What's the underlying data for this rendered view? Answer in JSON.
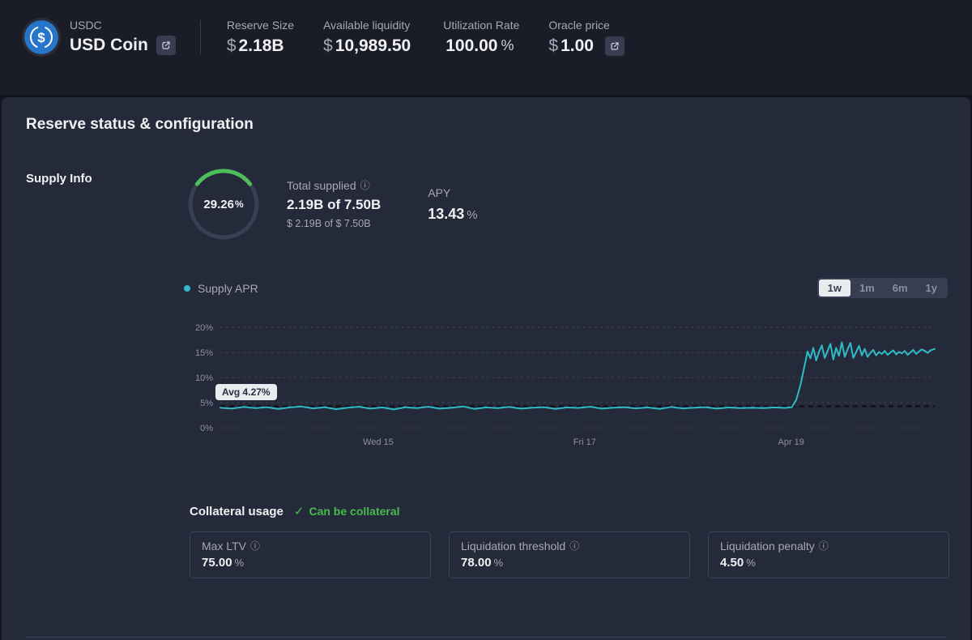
{
  "header": {
    "symbol": "USDC",
    "name": "USD Coin",
    "stats": [
      {
        "label": "Reserve Size",
        "prefix": "$",
        "value": "2.18B"
      },
      {
        "label": "Available liquidity",
        "prefix": "$",
        "value": "10,989.50"
      },
      {
        "label": "Utilization Rate",
        "prefix": "",
        "value": "100.00",
        "suffix": "%"
      },
      {
        "label": "Oracle price",
        "prefix": "$",
        "value": "1.00"
      }
    ]
  },
  "panel": {
    "title": "Reserve status & configuration",
    "section_label": "Supply Info"
  },
  "supply": {
    "gauge_percent": "29.26",
    "gauge_suffix": "%",
    "total_supplied_label": "Total supplied",
    "total_supplied": "2.19B of 7.50B",
    "total_supplied_usd": "$ 2.19B of $ 7.50B",
    "apy_label": "APY",
    "apy_value": "13.43",
    "apy_suffix": "%"
  },
  "chart": {
    "legend": "Supply APR",
    "ranges": [
      "1w",
      "1m",
      "6m",
      "1y"
    ],
    "selected_range": "1w",
    "avg_label": "Avg 4.27%"
  },
  "chart_data": {
    "type": "line",
    "title": "Supply APR",
    "ylim": [
      0,
      20
    ],
    "yticks": [
      0,
      5,
      10,
      15,
      20
    ],
    "ytick_labels": [
      "0%",
      "5%",
      "10%",
      "15%",
      "20%"
    ],
    "xtick_labels": [
      {
        "label": "Wed 15",
        "x": 0.221
      },
      {
        "label": "Fri 17",
        "x": 0.51
      },
      {
        "label": "Apr 19",
        "x": 0.799
      }
    ],
    "avg": 4.27,
    "grid": true,
    "legend_position": "top-left",
    "series": [
      {
        "name": "Supply APR",
        "color": "#2EBAC6",
        "points": [
          [
            0,
            4.0
          ],
          [
            0.016,
            3.8
          ],
          [
            0.033,
            4.15
          ],
          [
            0.049,
            3.9
          ],
          [
            0.065,
            4.1
          ],
          [
            0.081,
            3.75
          ],
          [
            0.097,
            4.05
          ],
          [
            0.113,
            4.25
          ],
          [
            0.13,
            3.85
          ],
          [
            0.146,
            4.1
          ],
          [
            0.162,
            3.7
          ],
          [
            0.178,
            4.0
          ],
          [
            0.194,
            4.2
          ],
          [
            0.21,
            3.8
          ],
          [
            0.227,
            4.05
          ],
          [
            0.243,
            3.65
          ],
          [
            0.259,
            4.1
          ],
          [
            0.275,
            3.9
          ],
          [
            0.291,
            4.2
          ],
          [
            0.307,
            3.8
          ],
          [
            0.324,
            4.0
          ],
          [
            0.34,
            4.25
          ],
          [
            0.356,
            3.75
          ],
          [
            0.372,
            4.05
          ],
          [
            0.388,
            3.9
          ],
          [
            0.404,
            4.15
          ],
          [
            0.421,
            3.8
          ],
          [
            0.437,
            4.0
          ],
          [
            0.453,
            4.1
          ],
          [
            0.469,
            3.75
          ],
          [
            0.485,
            4.05
          ],
          [
            0.501,
            3.95
          ],
          [
            0.518,
            4.2
          ],
          [
            0.534,
            3.8
          ],
          [
            0.55,
            4.0
          ],
          [
            0.566,
            4.1
          ],
          [
            0.582,
            3.85
          ],
          [
            0.598,
            4.05
          ],
          [
            0.615,
            3.75
          ],
          [
            0.631,
            4.15
          ],
          [
            0.647,
            3.85
          ],
          [
            0.663,
            4.0
          ],
          [
            0.679,
            4.1
          ],
          [
            0.695,
            3.8
          ],
          [
            0.712,
            4.05
          ],
          [
            0.728,
            3.9
          ],
          [
            0.744,
            4.0
          ],
          [
            0.76,
            3.9
          ],
          [
            0.776,
            4.05
          ],
          [
            0.79,
            3.95
          ],
          [
            0.8,
            4.1
          ],
          [
            0.806,
            5.5
          ],
          [
            0.812,
            8.5
          ],
          [
            0.818,
            12.5
          ],
          [
            0.822,
            15.2
          ],
          [
            0.826,
            13.8
          ],
          [
            0.83,
            15.9
          ],
          [
            0.834,
            13.4
          ],
          [
            0.838,
            15.1
          ],
          [
            0.842,
            16.4
          ],
          [
            0.846,
            13.9
          ],
          [
            0.85,
            15.3
          ],
          [
            0.854,
            16.7
          ],
          [
            0.858,
            13.6
          ],
          [
            0.862,
            15.9
          ],
          [
            0.866,
            14.3
          ],
          [
            0.87,
            17.0
          ],
          [
            0.874,
            14.1
          ],
          [
            0.878,
            15.6
          ],
          [
            0.882,
            16.9
          ],
          [
            0.886,
            13.9
          ],
          [
            0.89,
            15.1
          ],
          [
            0.894,
            16.3
          ],
          [
            0.898,
            14.4
          ],
          [
            0.902,
            15.7
          ],
          [
            0.906,
            14.1
          ],
          [
            0.91,
            14.9
          ],
          [
            0.914,
            15.5
          ],
          [
            0.918,
            14.4
          ],
          [
            0.922,
            15.1
          ],
          [
            0.926,
            14.7
          ],
          [
            0.93,
            15.3
          ],
          [
            0.934,
            14.5
          ],
          [
            0.938,
            15.0
          ],
          [
            0.942,
            15.4
          ],
          [
            0.946,
            14.6
          ],
          [
            0.95,
            15.1
          ],
          [
            0.954,
            14.8
          ],
          [
            0.958,
            15.3
          ],
          [
            0.962,
            14.5
          ],
          [
            0.966,
            15.0
          ],
          [
            0.97,
            15.5
          ],
          [
            0.974,
            14.7
          ],
          [
            0.978,
            15.2
          ],
          [
            0.982,
            15.6
          ],
          [
            0.986,
            15.3
          ],
          [
            0.99,
            14.9
          ],
          [
            0.994,
            15.4
          ],
          [
            1,
            15.7
          ]
        ]
      }
    ]
  },
  "collateral": {
    "title": "Collateral usage",
    "check_icon": "✓",
    "status": "Can be collateral",
    "items": [
      {
        "label": "Max LTV",
        "value": "75.00",
        "suffix": "%"
      },
      {
        "label": "Liquidation threshold",
        "value": "78.00",
        "suffix": "%"
      },
      {
        "label": "Liquidation penalty",
        "value": "4.50",
        "suffix": "%"
      }
    ]
  },
  "icons": {
    "info": "ⓘ"
  },
  "colors": {
    "accent_teal": "#2EBAC6",
    "success_green": "#46BC4B",
    "gauge_green": "#4dbd5a",
    "header_bg": "#1a1d28",
    "panel_bg": "#252a3b",
    "usdc_blue": "#2775CA"
  }
}
